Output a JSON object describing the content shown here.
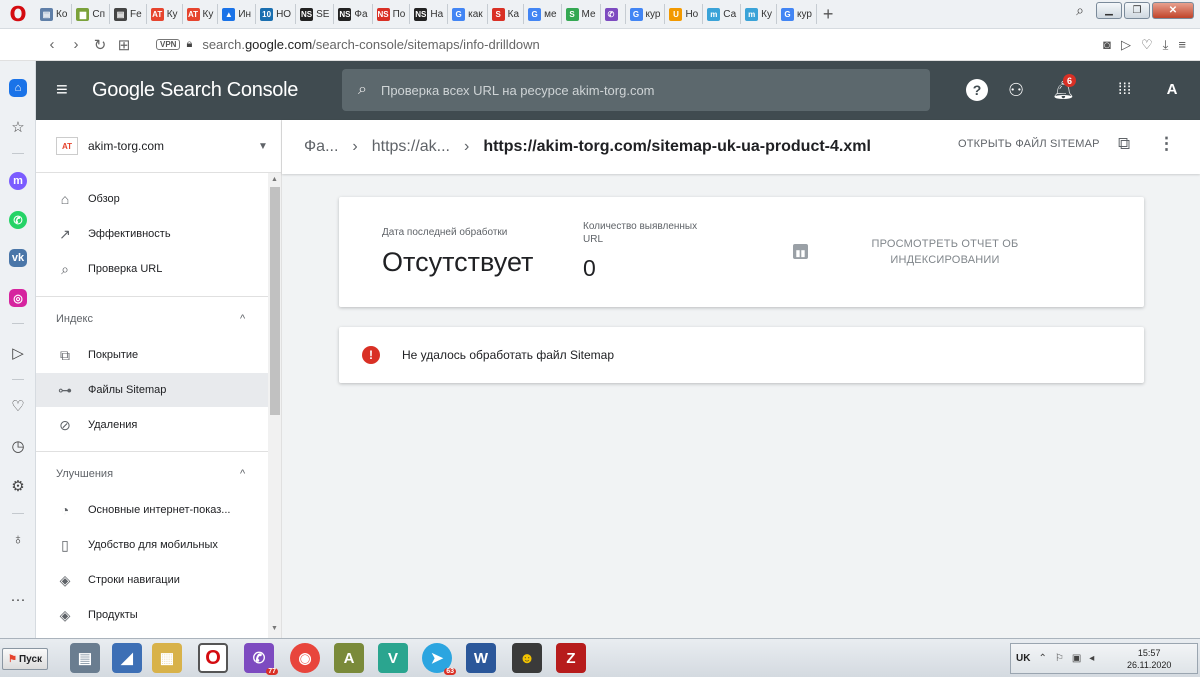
{
  "browser": {
    "tabs": [
      {
        "label": "Ко",
        "fav": "doc-icon",
        "color": "#5f7fa8"
      },
      {
        "label": "Сп",
        "fav": "folder-icon",
        "color": "#7aa13a"
      },
      {
        "label": "Fe",
        "fav": "doc-icon",
        "color": "#444444"
      },
      {
        "label": "Ку",
        "fav": "AT",
        "color": "#e6442e"
      },
      {
        "label": "Ку",
        "fav": "AT",
        "color": "#e6442e"
      },
      {
        "label": "Ин",
        "fav": "ads-icon",
        "color": "#1a73e8"
      },
      {
        "label": "НО",
        "fav": "10",
        "color": "#1a6fb0"
      },
      {
        "label": "SE",
        "fav": "NS",
        "color": "#222222"
      },
      {
        "label": "Фа",
        "fav": "NS",
        "color": "#222222"
      },
      {
        "label": "По",
        "fav": "NS",
        "color": "#d93025"
      },
      {
        "label": "На",
        "fav": "NS",
        "color": "#222222"
      },
      {
        "label": "как",
        "fav": "G",
        "color": "#4285f4"
      },
      {
        "label": "Ка",
        "fav": "S",
        "color": "#d93025"
      },
      {
        "label": "ме",
        "fav": "G",
        "color": "#4285f4"
      },
      {
        "label": "Ме",
        "fav": "S",
        "color": "#34a853"
      },
      {
        "label": "",
        "fav": "viber-icon",
        "color": "#7d4bc0"
      },
      {
        "label": "кур",
        "fav": "G",
        "color": "#4285f4"
      },
      {
        "label": "Но",
        "fav": "U",
        "color": "#f29900"
      },
      {
        "label": "Са",
        "fav": "m",
        "color": "#3aa3d8"
      },
      {
        "label": "Ку",
        "fav": "m",
        "color": "#3aa3d8"
      },
      {
        "label": "кур",
        "fav": "G",
        "color": "#4285f4"
      }
    ],
    "url_prefix": "search.",
    "url_domain": "google.com",
    "url_path": "/search-console/sitemaps/info-drilldown",
    "vpn_label": "VPN"
  },
  "header": {
    "logo": "Google Search Console",
    "search_placeholder": "Проверка всех URL на ресурсе akim-torg.com",
    "notification_count": "6",
    "avatar_letter": "A"
  },
  "nav": {
    "property_icon_text": "AT",
    "property_name": "akim-torg.com",
    "items_top": [
      {
        "label": "Обзор",
        "icon": "home-icon"
      },
      {
        "label": "Эффективность",
        "icon": "trending-icon"
      },
      {
        "label": "Проверка URL",
        "icon": "search-icon"
      }
    ],
    "section_index": "Индекс",
    "items_index": [
      {
        "label": "Покрытие",
        "icon": "coverage-icon"
      },
      {
        "label": "Файлы Sitemap",
        "icon": "sitemap-icon",
        "selected": true
      },
      {
        "label": "Удаления",
        "icon": "removals-icon"
      }
    ],
    "section_enhancements": "Улучшения",
    "items_enhancements": [
      {
        "label": "Основные интернет-показ...",
        "icon": "speed-icon"
      },
      {
        "label": "Удобство для мобильных",
        "icon": "mobile-icon"
      },
      {
        "label": "Строки навигации",
        "icon": "layers-icon"
      },
      {
        "label": "Продукты",
        "icon": "layers-icon"
      }
    ]
  },
  "breadcrumb": {
    "item1": "Фа...",
    "item2": "https://ak...",
    "current": "https://akim-torg.com/sitemap-uk-ua-product-4.xml",
    "open_sitemap": "ОТКРЫТЬ ФАЙЛ SITEMAP"
  },
  "stats": {
    "date_label": "Дата последней обработки",
    "date_value": "Отсутствует",
    "count_label_1": "Количество выявленных",
    "count_label_2": "URL",
    "count_value": "0",
    "report_line1": "ПРОСМОТРЕТЬ ОТЧЕТ ОБ",
    "report_line2": "ИНДЕКСИРОВАНИИ"
  },
  "error": {
    "message": "Не удалось обработать файл Sitemap"
  },
  "taskbar": {
    "start_label": "Пуск",
    "viber_badge": "77",
    "telegram_badge": "63",
    "lang": "UK",
    "time": "15:57",
    "date": "26.11.2020"
  },
  "colors": {
    "header_bg": "#404b50",
    "error_red": "#d93025",
    "selected_bg": "#e8eaed"
  }
}
